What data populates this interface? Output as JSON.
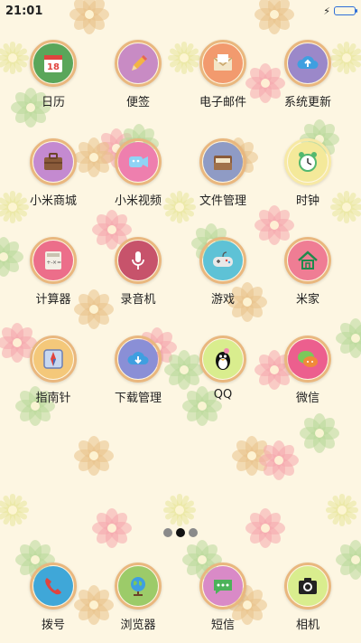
{
  "status_bar": {
    "time": "21:01",
    "battery_level": 1.0
  },
  "apps": [
    {
      "id": "calendar",
      "label": "日历",
      "icon": "calendar-icon",
      "bg": "#5aa65a",
      "ring": "#e9b77e",
      "glyph": "18"
    },
    {
      "id": "notes",
      "label": "便签",
      "icon": "pencil-icon",
      "bg": "#c88bc4",
      "ring": "#e9b77e"
    },
    {
      "id": "email",
      "label": "电子邮件",
      "icon": "envelope-icon",
      "bg": "#f29a6e",
      "ring": "#e9b77e"
    },
    {
      "id": "system-update",
      "label": "系统更新",
      "icon": "cloud-upload-icon",
      "bg": "#9b88c9",
      "ring": "#e9b77e"
    },
    {
      "id": "mi-store",
      "label": "小米商城",
      "icon": "briefcase-icon",
      "bg": "#c48ad0",
      "ring": "#e9b77e"
    },
    {
      "id": "mi-video",
      "label": "小米视频",
      "icon": "video-camera-icon",
      "bg": "#ee7fae",
      "ring": "#e9b77e"
    },
    {
      "id": "file-manager",
      "label": "文件管理",
      "icon": "folder-icon",
      "bg": "#8f9bc5",
      "ring": "#e9b77e"
    },
    {
      "id": "clock",
      "label": "时钟",
      "icon": "alarm-clock-icon",
      "bg": "#f4e99a",
      "ring": "#f7e9a5"
    },
    {
      "id": "calculator",
      "label": "计算器",
      "icon": "calculator-icon",
      "bg": "#ec6e8a",
      "ring": "#e9b77e"
    },
    {
      "id": "recorder",
      "label": "录音机",
      "icon": "microphone-icon",
      "bg": "#c7536b",
      "ring": "#e9b77e"
    },
    {
      "id": "games",
      "label": "游戏",
      "icon": "gamepad-icon",
      "bg": "#5ec2d6",
      "ring": "#e9b77e"
    },
    {
      "id": "mi-home",
      "label": "米家",
      "icon": "house-icon",
      "bg": "#ef7d94",
      "ring": "#e9b77e"
    },
    {
      "id": "compass",
      "label": "指南针",
      "icon": "compass-icon",
      "bg": "#f4c87a",
      "ring": "#e9b77e"
    },
    {
      "id": "downloads",
      "label": "下载管理",
      "icon": "cloud-download-icon",
      "bg": "#8a8fd6",
      "ring": "#e9b77e"
    },
    {
      "id": "qq",
      "label": "QQ",
      "icon": "penguin-icon",
      "bg": "#d9ed8e",
      "ring": "#e9b77e"
    },
    {
      "id": "wechat",
      "label": "微信",
      "icon": "chat-bubbles-icon",
      "bg": "#ec5f8e",
      "ring": "#e9b77e"
    }
  ],
  "page_indicator": {
    "count": 3,
    "active": 1
  },
  "dock": [
    {
      "id": "phone",
      "label": "拨号",
      "icon": "phone-icon",
      "bg": "#3fa7d8",
      "ring": "#e9b77e"
    },
    {
      "id": "browser",
      "label": "浏览器",
      "icon": "globe-icon",
      "bg": "#9ccb69",
      "ring": "#e9b77e"
    },
    {
      "id": "messages",
      "label": "短信",
      "icon": "message-icon",
      "bg": "#d98ac7",
      "ring": "#e9b77e"
    },
    {
      "id": "camera",
      "label": "相机",
      "icon": "camera-icon",
      "bg": "#d9ed8e",
      "ring": "#e9b77e"
    }
  ]
}
